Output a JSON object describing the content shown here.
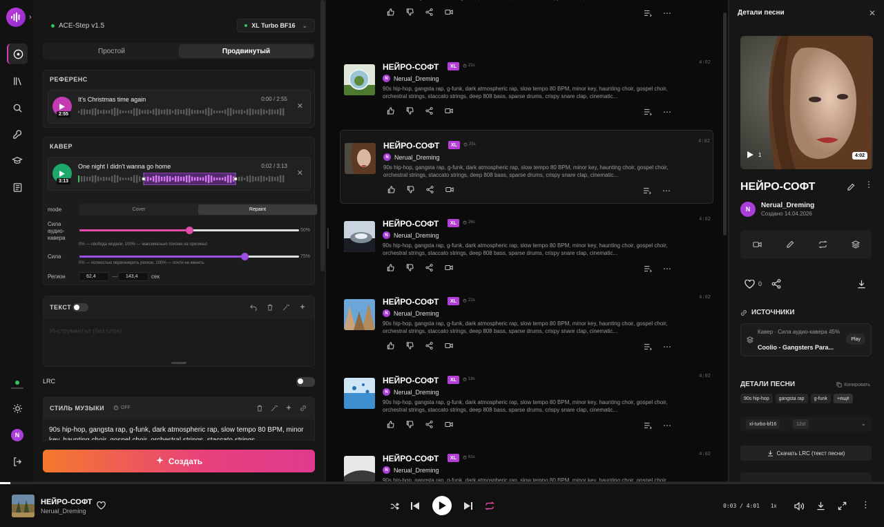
{
  "rail": {
    "nav_items": [
      "create",
      "library",
      "search",
      "tools",
      "learn",
      "docs"
    ],
    "avatar_letter": "N"
  },
  "generation_panel": {
    "model_status": "ACE-Step v1.5",
    "model_select": "XL Turbo BF16",
    "tabs": [
      {
        "label": "Простой",
        "active": false
      },
      {
        "label": "Продвинутый",
        "active": true
      }
    ],
    "reference": {
      "title": "РЕФЕРЕНС",
      "track_title": "It's Christmas time again",
      "time": "0:00 / 2:55",
      "duration_badge": "2:55"
    },
    "cover": {
      "title": "КАВЕР",
      "track_title": "One night I didn't wanna go home",
      "time": "0:02 / 3:13",
      "duration_badge": "3:13",
      "mode": {
        "label": "mode",
        "options": [
          "Cover",
          "Repaint"
        ],
        "active": "Repaint"
      },
      "strength_label": "Сила аудио-кавера",
      "strength_value": 0.5,
      "strength_pct": "50%",
      "strength_hint": "0% — свобода модели, 100% — максимально похоже на оригинал",
      "force_label": "Сила",
      "force_value": 0.75,
      "force_pct": "75%",
      "force_hint": "0% — полностью перегенерить регион, 100% — почти не менять",
      "region_label": "Регион",
      "region_start": "62,4",
      "region_sep": "—",
      "region_end": "143,4",
      "region_unit": "сек"
    },
    "lyrics": {
      "title": "ТЕКСТ",
      "placeholder": "Инструментал (без слов)"
    },
    "lrc_label": "LRC",
    "style": {
      "title": "СТИЛЬ МУЗЫКИ",
      "off_label": "OFF",
      "text": "90s hip-hop, gangsta rap, g-funk, dark atmospheric rap, slow tempo 80 BPM, minor key, haunting choir, gospel choir, orchestral strings, staccato strings"
    },
    "create_label": "Создать"
  },
  "feed": {
    "description": "90s hip-hop, gangsta rap, g-funk, dark atmospheric rap, slow tempo 80 BPM, minor key, haunting choir, gospel choir, orchestral strings, staccato strings, deep 808 bass, sparse drums, crispy snare clap, cinematic...",
    "songs": [
      {
        "title": "",
        "author": "",
        "badge": "",
        "gen_time": "",
        "duration": "",
        "thumb": "lake"
      },
      {
        "title": "НЕЙРО-СОФТ",
        "author": "Nerual_Dreming",
        "badge": "XL",
        "gen_time": "21s",
        "duration": "4:02",
        "thumb": "globe"
      },
      {
        "title": "НЕЙРО-СОФТ",
        "author": "Nerual_Dreming",
        "badge": "XL",
        "gen_time": "25s",
        "duration": "4:02",
        "thumb": "woman",
        "selected": true
      },
      {
        "title": "НЕЙРО-СОФТ",
        "author": "Nerual_Dreming",
        "badge": "XL",
        "gen_time": "26s",
        "duration": "4:02",
        "thumb": "metal"
      },
      {
        "title": "НЕЙРО-СОФТ",
        "author": "Nerual_Dreming",
        "badge": "XL",
        "gen_time": "22s",
        "duration": "4:02",
        "thumb": "sky"
      },
      {
        "title": "НЕЙРО-СОФТ",
        "author": "Nerual_Dreming",
        "badge": "XL",
        "gen_time": "19s",
        "duration": "4:02",
        "thumb": "splash"
      },
      {
        "title": "НЕЙРО-СОФТ",
        "author": "Nerual_Dreming",
        "badge": "XL",
        "gen_time": "61s",
        "duration": "4:02",
        "thumb": "abstract"
      }
    ]
  },
  "details": {
    "header": "Детали песни",
    "cover_plays": "1",
    "cover_duration": "4:02",
    "song_title": "НЕЙРО-СОФТ",
    "author": "Nerual_Dreming",
    "author_letter": "N",
    "created": "Создано 14.04.2026",
    "likes": "0",
    "sources_title": "ИСТОЧНИКИ",
    "source": {
      "kind": "Кавер",
      "kind_detail": " · Сила аудио-кавера 45%",
      "title": "Coolio - Gangsters Para...",
      "play_label": "Play"
    },
    "song_details_title": "ДЕТАЛИ ПЕСНИ",
    "copy_label": "Копировать",
    "tags": [
      "90s hip-hop",
      "gangsta rap",
      "g-funk",
      "+ещё"
    ],
    "model_tag": "xl-turbo-bf16",
    "steps_tag": "12st",
    "lrc_download": "Скачать LRC (текст песни)"
  },
  "player": {
    "title": "НЕЙРО-СОФТ",
    "author": "Nerual_Dreming",
    "time": "0:03 / 4:01",
    "speed": "1x",
    "progress": 0.012
  },
  "colors": {
    "accent_pink": "#d63cb3",
    "accent_purple": "#b43fd6",
    "success_green": "#34c35a",
    "create_gradient_start": "#f4792c",
    "create_gradient_end": "#df3a8e"
  }
}
